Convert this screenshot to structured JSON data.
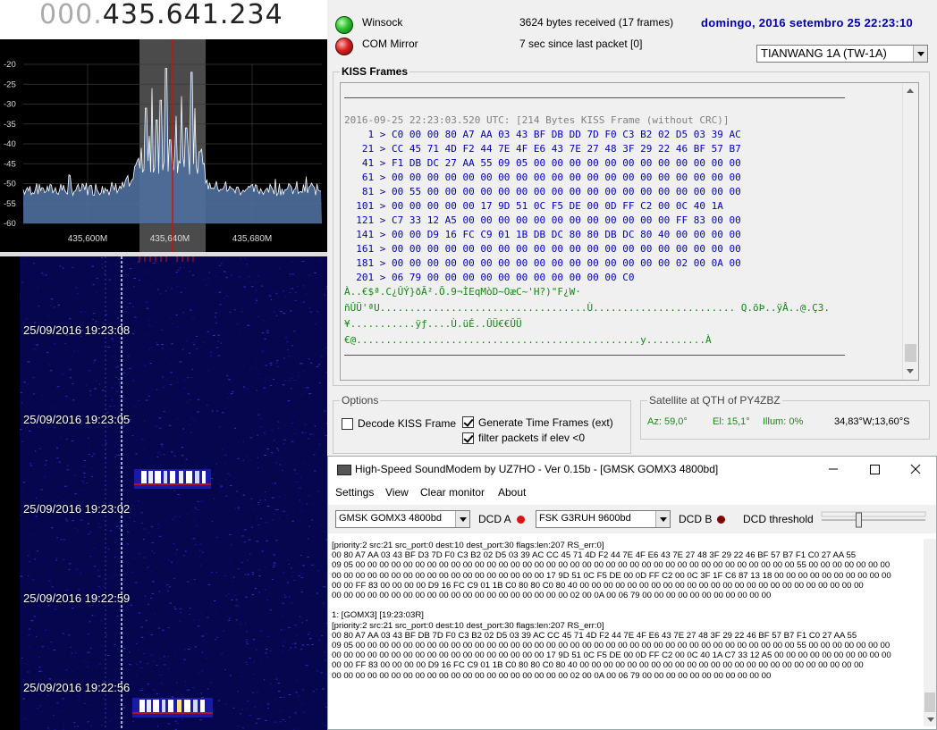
{
  "sdr": {
    "frequency_dim": "000.",
    "frequency_main": "435.641.234",
    "spectrum_db_labels": [
      "-20",
      "-25",
      "-30",
      "-35",
      "-40",
      "-45",
      "-50",
      "-55",
      "-60"
    ],
    "spectrum_freq_labels": [
      "435,600M",
      "435,640M",
      "435,680M"
    ],
    "waterfall_timestamps": [
      "25/09/2016 19:23:08",
      "25/09/2016 19:23:05",
      "25/09/2016 19:23:02",
      "25/09/2016 19:22:59",
      "25/09/2016 19:22:56"
    ],
    "colors": {
      "background": "#000000",
      "spectrum_fill": "#5a7fb5",
      "center_marker": "#d01010",
      "waterfall": "#0a0a6a"
    }
  },
  "decoder": {
    "winsock_label": "Winsock",
    "com_label": "COM Mirror",
    "bytes_received": "3624 bytes received (17 frames)",
    "since_last": "7 sec since last packet [0]",
    "datetime": "domingo, 2016 setembro 25  22:23:10",
    "satellite": "TIANWANG 1A (TW-1A)",
    "kiss_title": "KISS Frames",
    "kiss_header": "2016-09-25 22:23:03.520 UTC: [214 Bytes KISS Frame (without CRC)]",
    "kiss_hex": [
      "    1 > C0 00 00 80 A7 AA 03 43 BF DB DD 7D F0 C3 B2 02 D5 03 39 AC",
      "   21 > CC 45 71 4D F2 44 7E 4F E6 43 7E 27 48 3F 29 22 46 BF 57 B7",
      "   41 > F1 DB DC 27 AA 55 09 05 00 00 00 00 00 00 00 00 00 00 00 00",
      "   61 > 00 00 00 00 00 00 00 00 00 00 00 00 00 00 00 00 00 00 00 00",
      "   81 > 00 55 00 00 00 00 00 00 00 00 00 00 00 00 00 00 00 00 00 00",
      "  101 > 00 00 00 00 00 17 9D 51 0C F5 DE 00 0D FF C2 00 0C 40 1A",
      "  121 > C7 33 12 A5 00 00 00 00 00 00 00 00 00 00 00 00 FF 83 00 00",
      "  141 > 00 00 D9 16 FC C9 01 1B DB DC 80 80 DB DC 80 40 00 00 00 00",
      "  161 > 00 00 00 00 00 00 00 00 00 00 00 00 00 00 00 00 00 00 00 00",
      "  181 > 00 00 00 00 00 00 00 00 00 00 00 00 00 00 00 00 02 00 0A 00",
      "  201 > 06 79 00 00 00 00 00 00 00 00 00 00 00 C0"
    ],
    "kiss_ascii": [
      "À..€$ª.C¿ÛÝ}ðÃ².Õ.9¬ÌEqMòD~OæC~'H?)\"F¿W·",
      "ñÛÜ'ªU...................................Ù........................ Q.õÞ..ÿÂ..@.Ç3.",
      "¥...........ÿƒ....Ù.üÉ..ÛÜ€€ÛÜ",
      "€@................................................y..........À"
    ],
    "options": {
      "title": "Options",
      "decode_kiss": {
        "label": "Decode KISS Frame",
        "checked": false
      },
      "generate_time": {
        "label": "Generate Time Frames (ext)",
        "checked": true
      },
      "filter_elev": {
        "label": "filter packets if elev <0",
        "checked": true
      }
    },
    "qth": {
      "title": "Satellite at QTH of PY4ZBZ",
      "az": "Az: 59,0°",
      "el": "El: 15,1°",
      "illum": "Illum: 0%",
      "coords": "34,83°W;13,60°S"
    },
    "colors": {
      "hex_text": "#0000c8",
      "ascii_text": "#118a11",
      "header_text": "#808080",
      "datetime": "#0000b0"
    }
  },
  "soundmodem": {
    "title": "High-Speed SoundModem by UZ7HO - Ver 0.15b - [GMSK GOMX3 4800bd]",
    "menu": [
      "Settings",
      "View",
      "Clear monitor",
      "About"
    ],
    "modem_a": "GMSK GOMX3 4800bd",
    "dcd_a_label": "DCD A",
    "modem_b": "FSK G3RUH 9600bd",
    "dcd_b_label": "DCD B",
    "dcd_threshold_label": "DCD threshold",
    "dcd_threshold_level": 0.35,
    "monitor_lines": [
      "[priority:2 src:21 src_port:0 dest:10 dest_port:30 flags:len:207 RS_err:0]",
      "00 80 A7 AA 03 43 BF D3 7D F0 C3 B2 02 D5 03 39 AC CC 45 71 4D F2 44 7E 4F E6 43 7E 27 48 3F 29 22 46 BF 57 B7 F1 C0 27 AA 55",
      "09 05 00 00 00 00 00 00 00 00 00 00 00 00 00 00 00 00 00 00 00 00 00 00 00 00 00 00 00 00 00 00 00 00 00 00 00 00 00 55 00 00 00 00 00 00 00",
      "00 00 00 00 00 00 00 00 00 00 00 00 00 00 00 00 00 00 17 9D 51 0C F5 DE 00 0D FF C2 00 0C 3F 1F C6 87 13 18 00 00 00 00 00 00 00 00 00 00",
      "00 00 FF 83 00 00 00 00 D9 16 FC C9 01 1B C0 80 80 C0 80 40 00 00 00 00 00 00 00 00 00 00 00 00 00 00 00 00 00 00 00 00 00 00 00 00",
      "00 00 00 00 00 00 00 00 00 00 00 00 00 00 00 00 00 00 00 00 02 00 0A 00 06 79 00 00 00 00 00 00 00 00 00 00 00",
      "",
      "1: [GOMX3] [19:23:03R]",
      "[priority:2 src:21 src_port:0 dest:10 dest_port:30 flags:len:207 RS_err:0]",
      "00 80 A7 AA 03 43 BF DB 7D F0 C3 B2 02 D5 03 39 AC CC 45 71 4D F2 44 7E 4F E6 43 7E 27 48 3F 29 22 46 BF 57 B7 F1 C0 27 AA 55",
      "09 05 00 00 00 00 00 00 00 00 00 00 00 00 00 00 00 00 00 00 00 00 00 00 00 00 00 00 00 00 00 00 00 00 00 00 00 00 00 55 00 00 00 00 00 00 00",
      "00 00 00 00 00 00 00 00 00 00 00 00 00 00 00 00 00 00 17 9D 51 0C F5 DE 00 0D FF C2 00 0C 40 1A C7 33 12 A5 00 00 00 00 00 00 00 00 00 00",
      "00 00 FF 83 00 00 00 00 D9 16 FC C9 01 1B C0 80 80 C0 80 40 00 00 00 00 00 00 00 00 00 00 00 00 00 00 00 00 00 00 00 00 00 00 00 00",
      "00 00 00 00 00 00 00 00 00 00 00 00 00 00 00 00 00 00 00 00 02 00 0A 00 06 79 00 00 00 00 00 00 00 00 00 00 00"
    ],
    "icons": {
      "app": "modem-icon",
      "minimize": "minimize-icon",
      "maximize": "maximize-icon",
      "close": "close-icon"
    },
    "colors": {
      "dcd_a": "#e01010",
      "dcd_b": "#800000"
    }
  }
}
